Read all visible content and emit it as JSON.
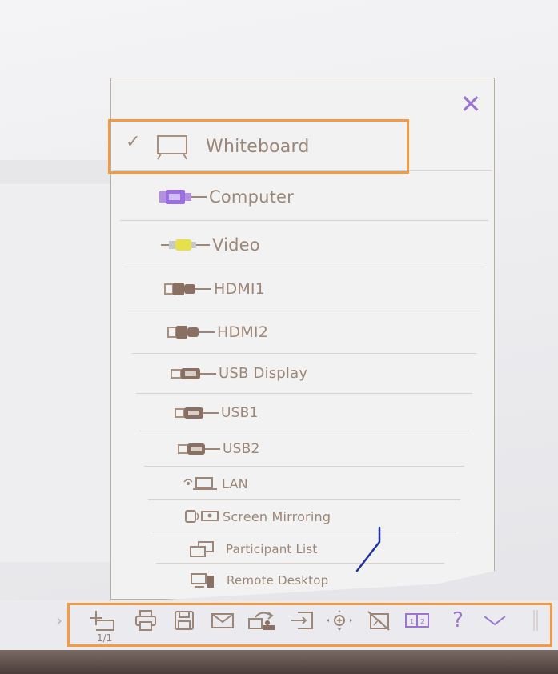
{
  "source_menu": {
    "items": [
      {
        "label": "Whiteboard",
        "icon": "whiteboard-icon",
        "selected": true
      },
      {
        "label": "Computer",
        "icon": "vga-connector-icon"
      },
      {
        "label": "Video",
        "icon": "rca-connector-icon"
      },
      {
        "label": "HDMI1",
        "icon": "hdmi-connector-icon"
      },
      {
        "label": "HDMI2",
        "icon": "hdmi-connector-icon"
      },
      {
        "label": "USB Display",
        "icon": "usb-connector-icon"
      },
      {
        "label": "USB1",
        "icon": "usb-connector-icon"
      },
      {
        "label": "USB2",
        "icon": "usb-connector-icon"
      },
      {
        "label": "LAN",
        "icon": "lan-icon"
      },
      {
        "label": "Screen Mirroring",
        "icon": "screen-mirroring-icon"
      },
      {
        "label": "Participant List",
        "icon": "participant-list-icon"
      },
      {
        "label": "Remote Desktop",
        "icon": "remote-desktop-icon"
      }
    ],
    "close_icon": "close-icon"
  },
  "toolbar": {
    "page_indicator": "1/1",
    "icons": [
      "add-page-icon",
      "print-icon",
      "save-icon",
      "mail-icon",
      "share-icon",
      "import-icon",
      "pan-zoom-icon",
      "hide-icon",
      "split-screen-icon",
      "help-icon",
      "collapse-icon"
    ],
    "help_glyph": "?"
  },
  "colors": {
    "highlight": "#f39a45",
    "accent": "#9b75cf",
    "text": "#9b8677"
  }
}
